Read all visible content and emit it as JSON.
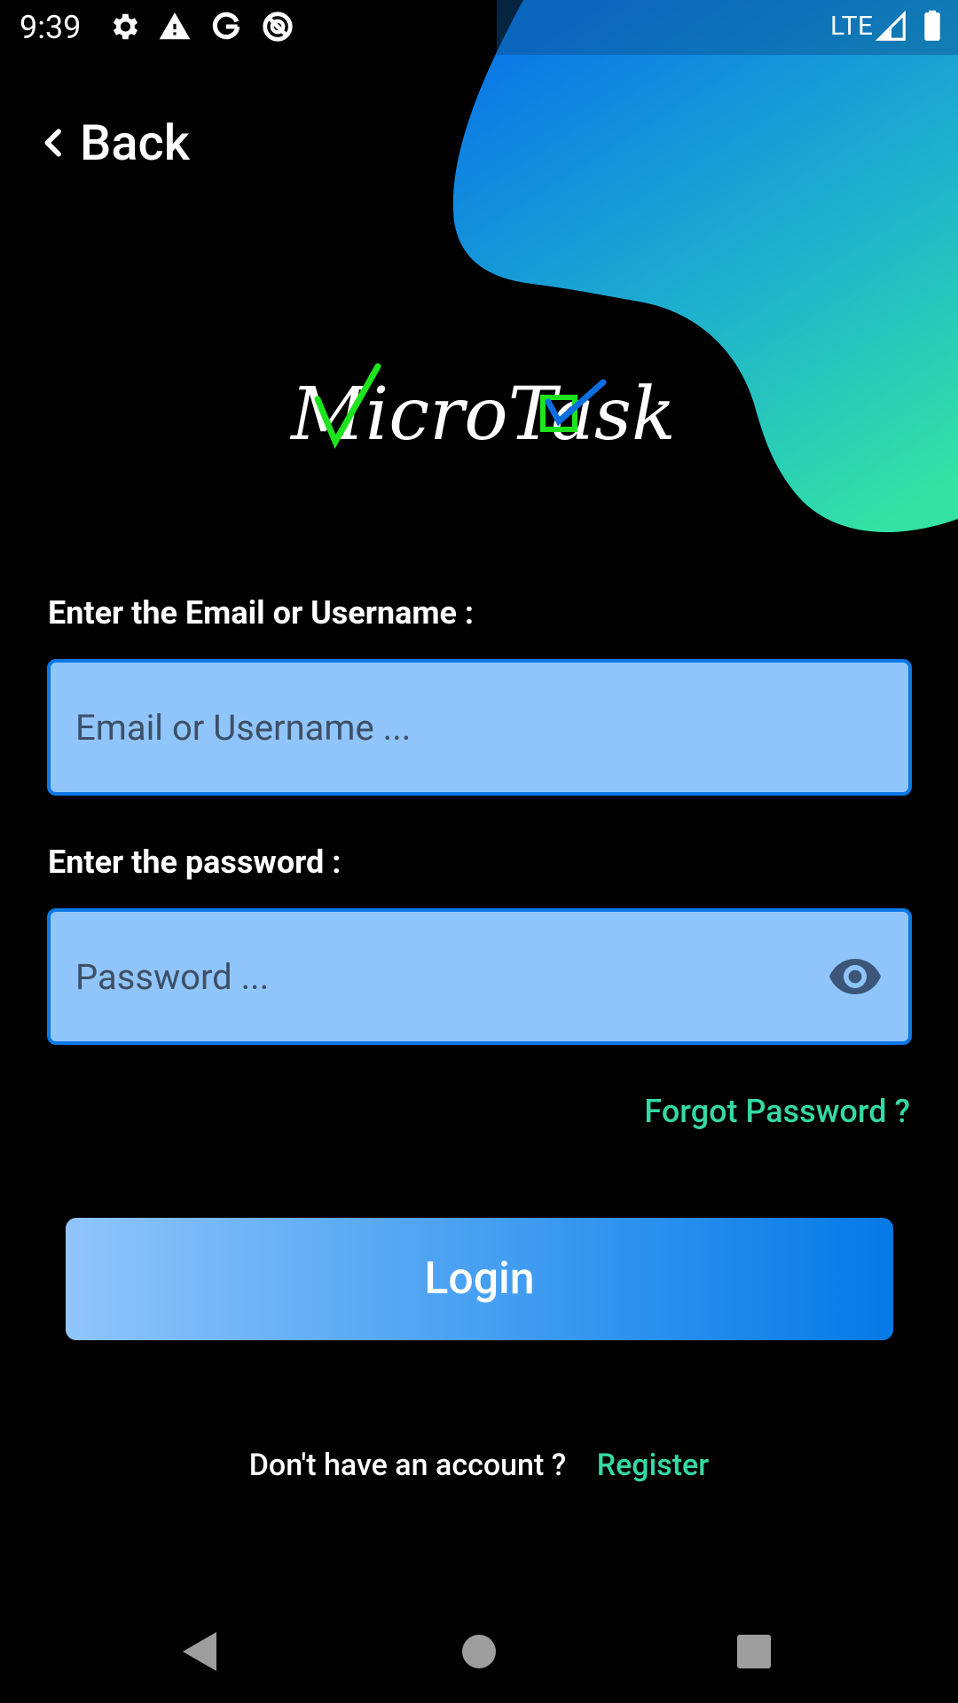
{
  "status_bar": {
    "time": "9:39",
    "network": "LTE",
    "icons": [
      "settings-icon",
      "warning-icon",
      "google-icon",
      "vpn-icon",
      "signal-icon",
      "battery-icon"
    ]
  },
  "header": {
    "back_label": "Back",
    "back_icon": "chevron-left-icon"
  },
  "logo": {
    "text": "MicroTask",
    "accent_colors": [
      "#1de41d",
      "#0b6fe0"
    ]
  },
  "form": {
    "email_label": "Enter the Email or Username :",
    "email_placeholder": "Email or Username ...",
    "email_value": "",
    "password_label": "Enter the password :",
    "password_placeholder": "Password ...",
    "password_value": "",
    "password_toggle_icon": "eye-icon",
    "forgot_password": "Forgot Password ?",
    "login_label": "Login"
  },
  "footer": {
    "register_prompt": "Don't have an account ?",
    "register_link": "Register"
  },
  "nav": [
    "back-triangle-icon",
    "home-circle-icon",
    "recents-square-icon"
  ],
  "colors": {
    "background": "#000000",
    "field_fill": "#90c5fb",
    "field_border": "#0b78e6",
    "link_green": "#34d9a5",
    "blob_start": "#0b78e6",
    "blob_end": "#34e0a6"
  }
}
